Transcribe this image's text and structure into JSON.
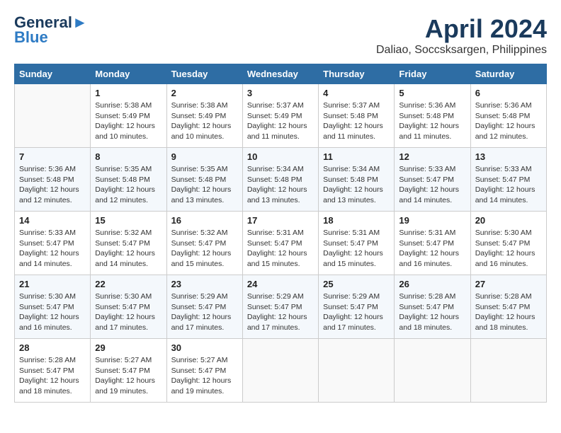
{
  "header": {
    "logo_line1": "General",
    "logo_line2": "Blue",
    "month": "April 2024",
    "location": "Daliao, Soccsksargen, Philippines"
  },
  "weekdays": [
    "Sunday",
    "Monday",
    "Tuesday",
    "Wednesday",
    "Thursday",
    "Friday",
    "Saturday"
  ],
  "weeks": [
    [
      {
        "day": "",
        "info": ""
      },
      {
        "day": "1",
        "info": "Sunrise: 5:38 AM\nSunset: 5:49 PM\nDaylight: 12 hours\nand 10 minutes."
      },
      {
        "day": "2",
        "info": "Sunrise: 5:38 AM\nSunset: 5:49 PM\nDaylight: 12 hours\nand 10 minutes."
      },
      {
        "day": "3",
        "info": "Sunrise: 5:37 AM\nSunset: 5:49 PM\nDaylight: 12 hours\nand 11 minutes."
      },
      {
        "day": "4",
        "info": "Sunrise: 5:37 AM\nSunset: 5:48 PM\nDaylight: 12 hours\nand 11 minutes."
      },
      {
        "day": "5",
        "info": "Sunrise: 5:36 AM\nSunset: 5:48 PM\nDaylight: 12 hours\nand 11 minutes."
      },
      {
        "day": "6",
        "info": "Sunrise: 5:36 AM\nSunset: 5:48 PM\nDaylight: 12 hours\nand 12 minutes."
      }
    ],
    [
      {
        "day": "7",
        "info": "Sunrise: 5:36 AM\nSunset: 5:48 PM\nDaylight: 12 hours\nand 12 minutes."
      },
      {
        "day": "8",
        "info": "Sunrise: 5:35 AM\nSunset: 5:48 PM\nDaylight: 12 hours\nand 12 minutes."
      },
      {
        "day": "9",
        "info": "Sunrise: 5:35 AM\nSunset: 5:48 PM\nDaylight: 12 hours\nand 13 minutes."
      },
      {
        "day": "10",
        "info": "Sunrise: 5:34 AM\nSunset: 5:48 PM\nDaylight: 12 hours\nand 13 minutes."
      },
      {
        "day": "11",
        "info": "Sunrise: 5:34 AM\nSunset: 5:48 PM\nDaylight: 12 hours\nand 13 minutes."
      },
      {
        "day": "12",
        "info": "Sunrise: 5:33 AM\nSunset: 5:47 PM\nDaylight: 12 hours\nand 14 minutes."
      },
      {
        "day": "13",
        "info": "Sunrise: 5:33 AM\nSunset: 5:47 PM\nDaylight: 12 hours\nand 14 minutes."
      }
    ],
    [
      {
        "day": "14",
        "info": "Sunrise: 5:33 AM\nSunset: 5:47 PM\nDaylight: 12 hours\nand 14 minutes."
      },
      {
        "day": "15",
        "info": "Sunrise: 5:32 AM\nSunset: 5:47 PM\nDaylight: 12 hours\nand 14 minutes."
      },
      {
        "day": "16",
        "info": "Sunrise: 5:32 AM\nSunset: 5:47 PM\nDaylight: 12 hours\nand 15 minutes."
      },
      {
        "day": "17",
        "info": "Sunrise: 5:31 AM\nSunset: 5:47 PM\nDaylight: 12 hours\nand 15 minutes."
      },
      {
        "day": "18",
        "info": "Sunrise: 5:31 AM\nSunset: 5:47 PM\nDaylight: 12 hours\nand 15 minutes."
      },
      {
        "day": "19",
        "info": "Sunrise: 5:31 AM\nSunset: 5:47 PM\nDaylight: 12 hours\nand 16 minutes."
      },
      {
        "day": "20",
        "info": "Sunrise: 5:30 AM\nSunset: 5:47 PM\nDaylight: 12 hours\nand 16 minutes."
      }
    ],
    [
      {
        "day": "21",
        "info": "Sunrise: 5:30 AM\nSunset: 5:47 PM\nDaylight: 12 hours\nand 16 minutes."
      },
      {
        "day": "22",
        "info": "Sunrise: 5:30 AM\nSunset: 5:47 PM\nDaylight: 12 hours\nand 17 minutes."
      },
      {
        "day": "23",
        "info": "Sunrise: 5:29 AM\nSunset: 5:47 PM\nDaylight: 12 hours\nand 17 minutes."
      },
      {
        "day": "24",
        "info": "Sunrise: 5:29 AM\nSunset: 5:47 PM\nDaylight: 12 hours\nand 17 minutes."
      },
      {
        "day": "25",
        "info": "Sunrise: 5:29 AM\nSunset: 5:47 PM\nDaylight: 12 hours\nand 17 minutes."
      },
      {
        "day": "26",
        "info": "Sunrise: 5:28 AM\nSunset: 5:47 PM\nDaylight: 12 hours\nand 18 minutes."
      },
      {
        "day": "27",
        "info": "Sunrise: 5:28 AM\nSunset: 5:47 PM\nDaylight: 12 hours\nand 18 minutes."
      }
    ],
    [
      {
        "day": "28",
        "info": "Sunrise: 5:28 AM\nSunset: 5:47 PM\nDaylight: 12 hours\nand 18 minutes."
      },
      {
        "day": "29",
        "info": "Sunrise: 5:27 AM\nSunset: 5:47 PM\nDaylight: 12 hours\nand 19 minutes."
      },
      {
        "day": "30",
        "info": "Sunrise: 5:27 AM\nSunset: 5:47 PM\nDaylight: 12 hours\nand 19 minutes."
      },
      {
        "day": "",
        "info": ""
      },
      {
        "day": "",
        "info": ""
      },
      {
        "day": "",
        "info": ""
      },
      {
        "day": "",
        "info": ""
      }
    ]
  ]
}
